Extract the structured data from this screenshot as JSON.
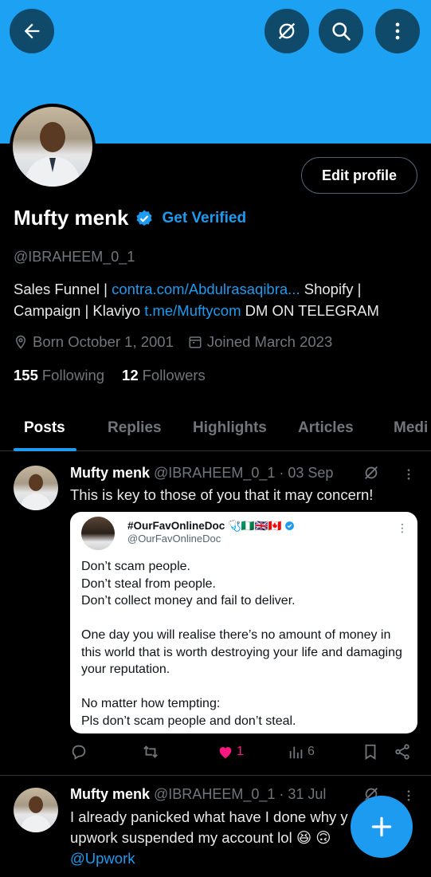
{
  "header": {
    "back_icon": "arrow-left-icon",
    "grok_icon": "no-grok-icon",
    "search_icon": "search-icon",
    "more_icon": "more-vertical-icon",
    "banner_color": "#1da1f2"
  },
  "profile": {
    "edit_label": "Edit profile",
    "name": "Mufty menk",
    "get_verified": "Get Verified",
    "handle": "@IBRAHEEM_0_1",
    "bio": {
      "part1": "Sales Funnel | ",
      "link1": "contra.com/Abdulrasaqibra...",
      "part2": " Shopify | Campaign | Klaviyo  ",
      "link2": "t.me/Muftycom",
      "part3": " DM ON TELEGRAM"
    },
    "born": "Born October 1, 2001",
    "joined": "Joined March 2023",
    "following_count": "155",
    "following_label": "Following",
    "followers_count": "12",
    "followers_label": "Followers"
  },
  "tabs": [
    "Posts",
    "Replies",
    "Highlights",
    "Articles",
    "Medi"
  ],
  "tweets": [
    {
      "name": "Mufty menk",
      "meta": "@IBRAHEEM_0_1 · 03 Sep",
      "text": "This is key to those of you that it may concern!",
      "quote": {
        "name": "#OurFavOnlineDoc",
        "name_suffix": "🩺🇳🇬🇬🇧🇨🇦",
        "handle": "@OurFavOnlineDoc",
        "line1": "Don’t scam people.",
        "line2": "Don’t steal from people.",
        "line3": "Don’t collect money and fail to deliver.",
        "para2": "One day you will realise there’s no amount of money in this world that is worth destroying your life and damaging your reputation.",
        "line4": "No matter how tempting:",
        "line5": "Pls don’t scam people and don’t steal."
      },
      "likes": "1",
      "views": "6"
    },
    {
      "name": "Mufty menk",
      "meta": "@IBRAHEEM_0_1 · 31 Jul",
      "text": "I already panicked what have I done why y upwork suspended my account lol 😆 🙃",
      "mention": "@Upwork"
    }
  ],
  "colors": {
    "accent": "#1d9bf0",
    "like": "#f91880",
    "muted": "#71767b"
  }
}
